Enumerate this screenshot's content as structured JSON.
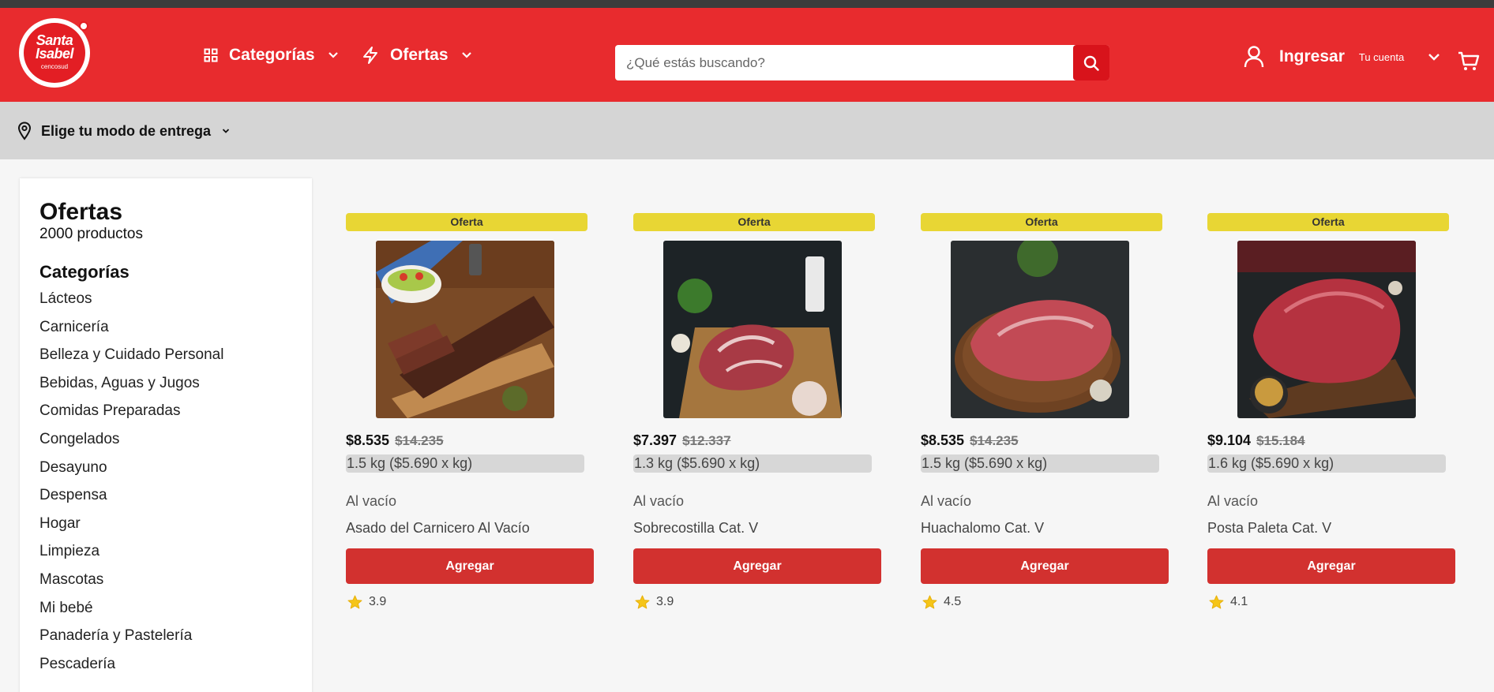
{
  "header": {
    "logo": {
      "line1": "Santa",
      "line2": "Isabel",
      "sub": "cencosud"
    },
    "nav": [
      {
        "label": "Categorías",
        "icon": "grid-icon"
      },
      {
        "label": "Ofertas",
        "icon": "lightning-icon"
      }
    ],
    "search": {
      "placeholder": "¿Qué estás buscando?",
      "value": ""
    },
    "account": {
      "label": "Ingresar",
      "sub": "Tu cuenta"
    },
    "colors": {
      "brand": "#e82b2e",
      "search_button": "#d8131b",
      "add_button": "#d2312f",
      "badge": "#e8d634"
    }
  },
  "delivery": {
    "label": "Elige tu modo de entrega"
  },
  "sidebar": {
    "title": "Ofertas",
    "count": "2000 productos",
    "categories_title": "Categorías",
    "categories": [
      "Lácteos",
      "Carnicería",
      "Belleza y Cuidado Personal",
      "Bebidas, Aguas y Jugos",
      "Comidas Preparadas",
      "Congelados",
      "Desayuno",
      "Despensa",
      "Hogar",
      "Limpieza",
      "Mascotas",
      "Mi bebé",
      "Panadería y Pastelería",
      "Pescadería"
    ]
  },
  "products": [
    {
      "badge": "Oferta",
      "price": "$8.535",
      "old_price": "$14.235",
      "unit": "1.5 kg ($5.690 x kg)",
      "brand": "Al vacío",
      "name": "Asado del Carnicero Al Vacío",
      "button": "Agregar",
      "rating": "3.9"
    },
    {
      "badge": "Oferta",
      "price": "$7.397",
      "old_price": "$12.337",
      "unit": "1.3 kg ($5.690 x kg)",
      "brand": "Al vacío",
      "name": "Sobrecostilla Cat. V",
      "button": "Agregar",
      "rating": "3.9"
    },
    {
      "badge": "Oferta",
      "price": "$8.535",
      "old_price": "$14.235",
      "unit": "1.5 kg ($5.690 x kg)",
      "brand": "Al vacío",
      "name": "Huachalomo Cat. V",
      "button": "Agregar",
      "rating": "4.5"
    },
    {
      "badge": "Oferta",
      "price": "$9.104",
      "old_price": "$15.184",
      "unit": "1.6 kg ($5.690 x kg)",
      "brand": "Al vacío",
      "name": "Posta Paleta Cat. V",
      "button": "Agregar",
      "rating": "4.1"
    }
  ]
}
